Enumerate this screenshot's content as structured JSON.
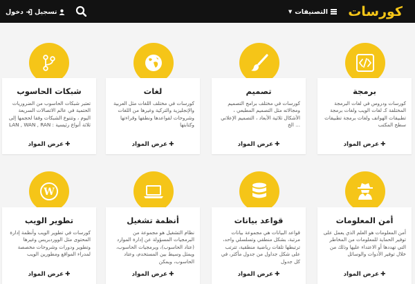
{
  "navbar": {
    "logo_text": "كورسات",
    "categories_label": "التصنيفات",
    "register_label": "تسجيل",
    "login_label": "دخول"
  },
  "colors": {
    "accent": "#f5c518",
    "navbar_bg": "#121212"
  },
  "cards": [
    {
      "title": "برمجة",
      "icon": "code-icon",
      "desc": "كورسات ودروس في لغات البرمجة المختلفة كـ لغات الويب ولغات برمجة تطبيقات الهواتف ولغات برمجة تطبيقات سطح المكتب",
      "button": "عرض المواد"
    },
    {
      "title": "تصميم",
      "icon": "paintbrush-icon",
      "desc": "كورسات في مختلف برامج التصميم ومجالاته مثل التصميم المطبعي ، الأشكال ثلاثية الأبعاد ، التصميم الإعلاني ... الخ",
      "button": "عرض المواد"
    },
    {
      "title": "لغات",
      "icon": "globe-icon",
      "desc": "كورسات في مختلف اللغات مثل العربية والإنجليزية والتركية وغيرها من اللغات وشروحات لقواعدها ونطقها وقراءتها وكتابتها",
      "button": "عرض المواد"
    },
    {
      "title": "شبكات الحاسوب",
      "icon": "network-icon",
      "desc": "تعتبر شبكات الحاسوب من الضروريات الحتمية في عالم الاتصالات السريعة اليوم ، وتتنوع الشبكات وفقا لحجمها إلى ثلاثة أنواع رئيسية : LAN , WAN , RAN",
      "button": "عرض المواد"
    },
    {
      "title": "أمن المعلومات",
      "icon": "spy-icon",
      "desc": "أمن المعلومات هو العلم الذي يعمل على توفير الحماية للمعلومات من المخاطر التي تهددها أو الاعتداء عليها وذلك من خلال توفير الأدوات والوسائل",
      "button": "عرض المواد"
    },
    {
      "title": "قواعد بيانات",
      "icon": "database-icon",
      "desc": "قواعد البيانات هي مجموعة بيانات مرتبة، بشكل منطقي وتسلسلي واحد، ترتبطها تلقات رياضية منطقية، تترتب على شكل جداول من جدول مأكثر، في كل جدول",
      "button": "عرض المواد"
    },
    {
      "title": "أنظمة تشغيل",
      "icon": "laptop-icon",
      "desc": "نظام التشغيل هو مجموعة من البرمجيات المسؤولة عن إدارة الموارد (عتاد الحاسوب)، وبرمجيات الحاسوب، ويمثل وسيط بين المستخدم، وعتاد الحاسوب، ويمكن",
      "button": "عرض المواد"
    },
    {
      "title": "تطوير الويب",
      "icon": "wordpress-icon",
      "desc": "كورسات في تطوير الويب وأنظمة إدارة المحتوى مثل الووردبريس وغيرها وتطوير ودورات وشروحات مخصصة لمدراء المواقع ومطورين الويب",
      "button": "عرض المواد"
    }
  ]
}
